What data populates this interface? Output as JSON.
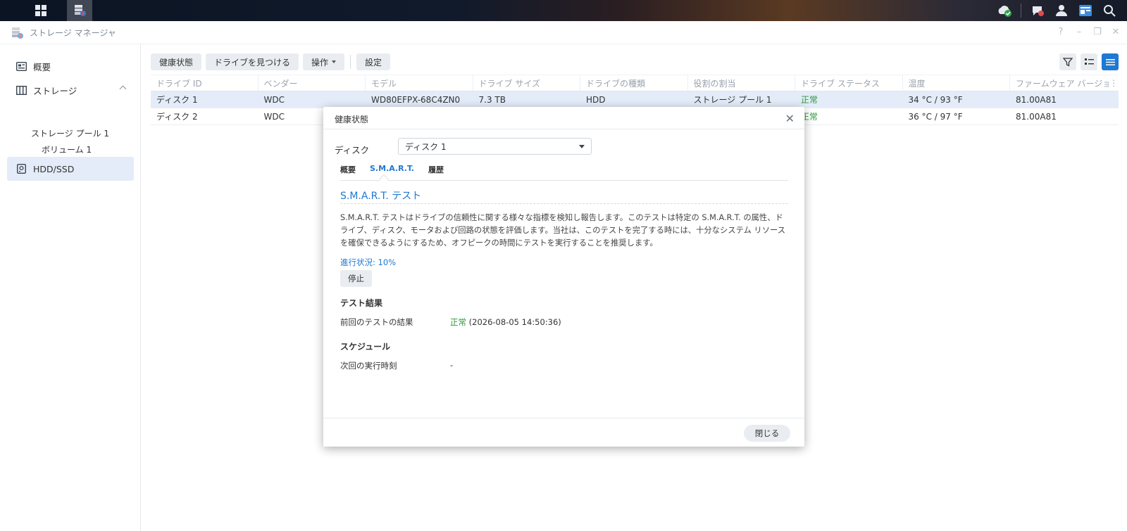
{
  "window": {
    "title": "ストレージ マネージャ"
  },
  "sidebar": {
    "overview": "概要",
    "storage": "ストレージ",
    "pool": "ストレージ プール 1",
    "volume": "ボリューム 1",
    "hdd": "HDD/SSD"
  },
  "toolbar": {
    "health": "健康状態",
    "find_drive": "ドライブを見つける",
    "actions": "操作",
    "settings": "設定"
  },
  "table": {
    "columns": [
      "ドライブ ID",
      "ベンダー",
      "モデル",
      "ドライブ サイズ",
      "ドライブの種類",
      "役割の割当",
      "ドライブ ステータス",
      "温度",
      "ファームウェア バージョン"
    ],
    "rows": [
      [
        "ディスク 1",
        "WDC",
        "WD80EFPX-68C4ZN0",
        "7.3 TB",
        "HDD",
        "ストレージ プール 1",
        "正常",
        "34 °C / 93 °F",
        "81.00A81"
      ],
      [
        "ディスク 2",
        "WDC",
        "",
        "",
        "",
        "",
        "正常",
        "36 °C / 97 °F",
        "81.00A81"
      ]
    ]
  },
  "dialog": {
    "title": "健康状態",
    "disk_label": "ディスク",
    "disk_value": "ディスク 1",
    "tabs": [
      "概要",
      "S.M.A.R.T.",
      "履歴"
    ],
    "section_title": "S.M.A.R.T. テスト",
    "description": "S.M.A.R.T. テストはドライブの信頼性に関する様々な指標を検知し報告します。このテストは特定の S.M.A.R.T. の属性、ドライブ、ディスク、モータおよび回路の状態を評価します。当社は、このテストを完了する時には、十分なシステム リソースを確保できるようにするため、オフピークの時間にテストを実行することを推奨します。",
    "progress": "進行状況: 10%",
    "stop": "停止",
    "results_head": "テスト結果",
    "last_result_key": "前回のテストの結果",
    "last_result_status": "正常",
    "last_result_time": "(2026-08-05 14:50:36)",
    "schedule_head": "スケジュール",
    "next_run_key": "次回の実行時刻",
    "next_run_value": "-",
    "close": "閉じる"
  }
}
